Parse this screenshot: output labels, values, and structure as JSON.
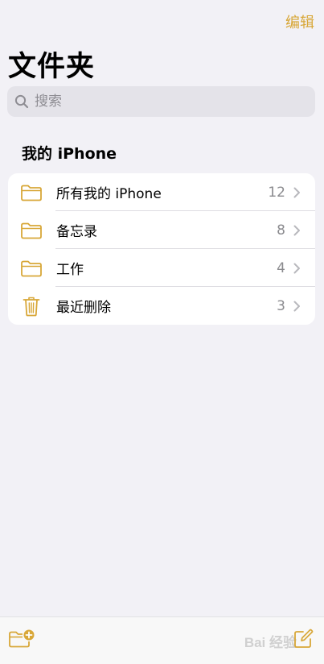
{
  "nav": {
    "edit_label": "编辑",
    "title": "文件夹"
  },
  "search": {
    "placeholder": "搜索",
    "icon": "magnifier"
  },
  "section": {
    "title": "我的 iPhone"
  },
  "folders": [
    {
      "label": "所有我的 iPhone",
      "count": "12",
      "icon": "folder-icon"
    },
    {
      "label": "备忘录",
      "count": "8",
      "icon": "folder-icon"
    },
    {
      "label": "工作",
      "count": "4",
      "icon": "folder-icon"
    },
    {
      "label": "最近删除",
      "count": "3",
      "icon": "trash-icon"
    }
  ],
  "toolbar": {
    "new_folder_icon": "new-folder-icon",
    "compose_icon": "compose-icon"
  },
  "watermark": {
    "text": "Bai 经验"
  },
  "colors": {
    "accent": "#d8a738",
    "background": "#f2f1f6",
    "secondary_text": "#8a8a8e"
  }
}
